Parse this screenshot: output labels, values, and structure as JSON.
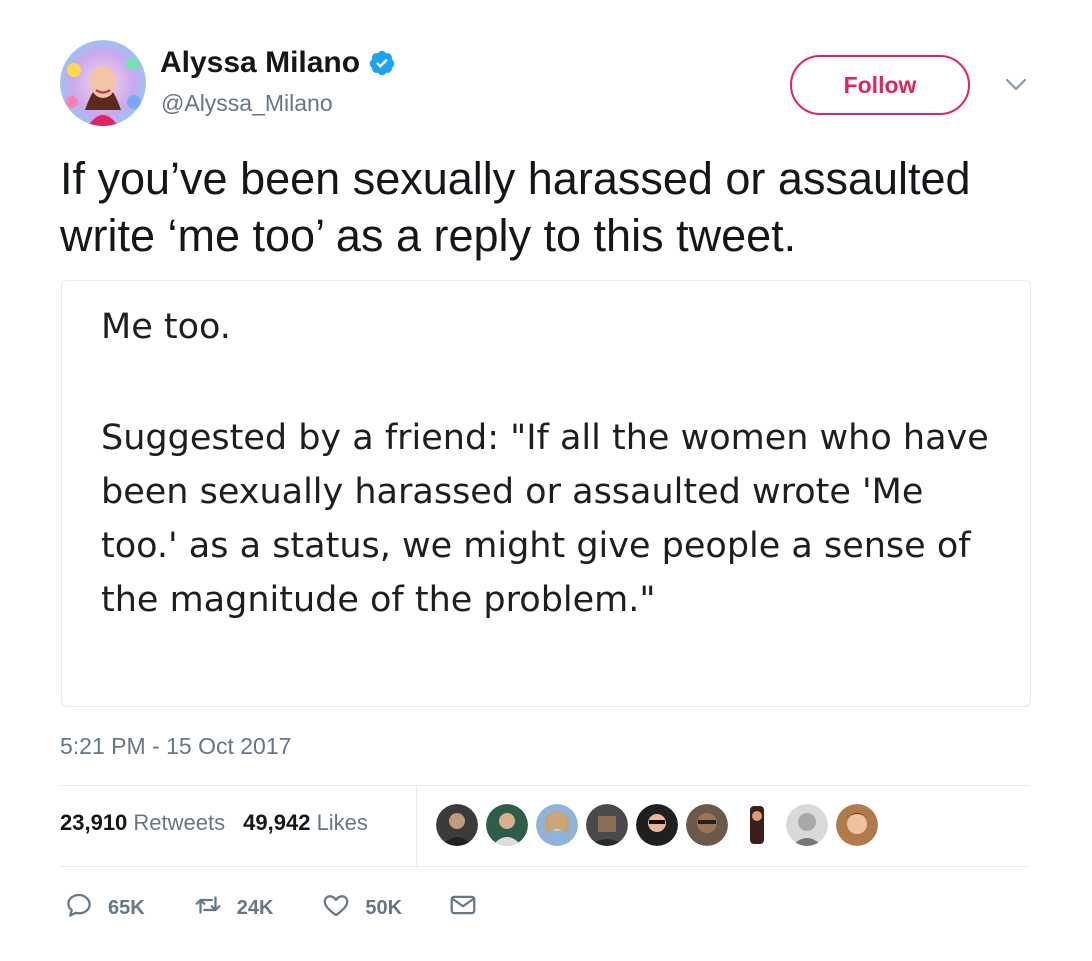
{
  "author": {
    "display_name": "Alyssa Milano",
    "handle": "@Alyssa_Milano",
    "verified": true
  },
  "follow_label": "Follow",
  "tweet": {
    "text": "If you’ve been sexually harassed or assaulted write ‘me too’ as a reply to this tweet.",
    "timestamp": "5:21 PM - 15 Oct 2017"
  },
  "card": {
    "line1": "Me too.",
    "body": "Suggested by a friend: \"If all the women who have been sexually harassed or assaulted wrote 'Me too.' as a status, we might give people a sense of the magnitude of the problem.\""
  },
  "stats": {
    "retweets_count": "23,910",
    "retweets_label": "Retweets",
    "likes_count": "49,942",
    "likes_label": "Likes"
  },
  "actions": {
    "replies": "65K",
    "retweets": "24K",
    "likes": "50K"
  },
  "icons": {
    "verified": "verified-badge-icon",
    "caret": "chevron-down-icon",
    "reply": "reply-icon",
    "retweet": "retweet-icon",
    "like": "heart-icon",
    "message": "envelope-icon"
  },
  "colors": {
    "accent": "#e0245e",
    "verified": "#1da1f2",
    "secondary_text": "#657786",
    "divider": "#e6ecf0"
  },
  "likers_count_shown": 9
}
